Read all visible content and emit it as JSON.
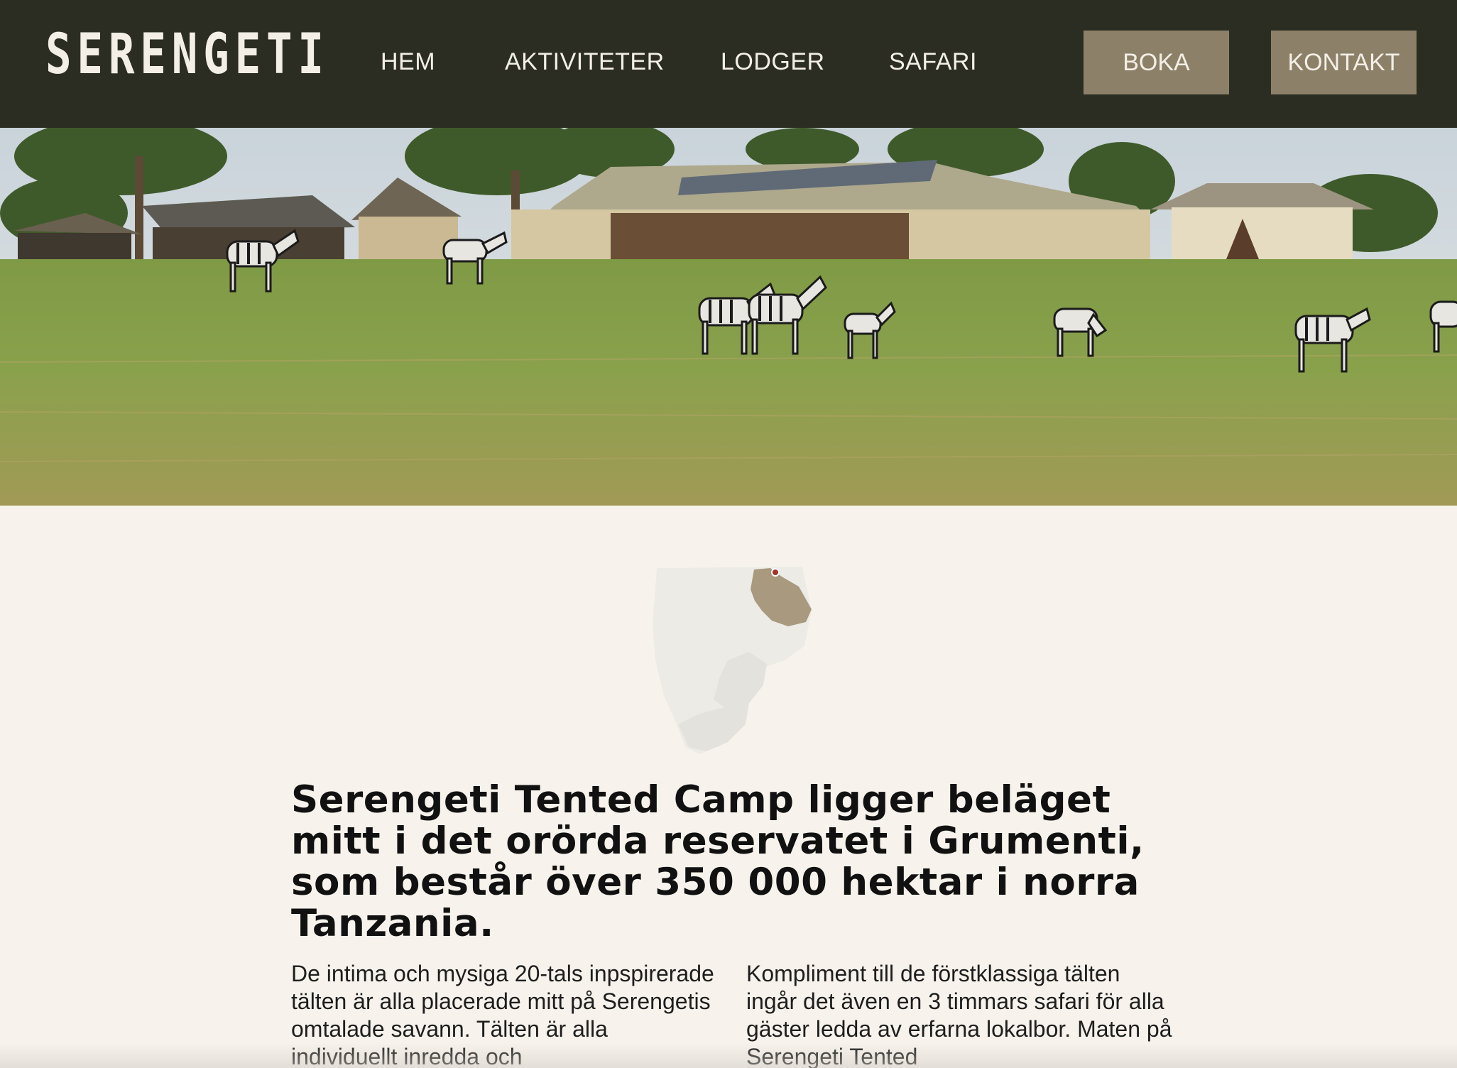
{
  "header": {
    "logo": "SERENGETI",
    "nav": [
      {
        "label": "HEM"
      },
      {
        "label": "AKTIVITETER"
      },
      {
        "label": "LODGER"
      },
      {
        "label": "SAFARI"
      }
    ],
    "boka_label": "BOKA",
    "kontakt_label": "KONTAKT"
  },
  "colors": {
    "nav_bg": "#2b2d23",
    "button_bg": "#8d8068",
    "page_bg": "#f7f3ec",
    "map_highlight": "#a8997f",
    "map_marker": "#a0352a"
  },
  "hero": {
    "image": "photo of safari tent camp with zebras grazing on savanna"
  },
  "intro": {
    "headline": "Serengeti Tented Camp ligger beläget mitt i det orörda reservatet i Grumenti, som består över 350 000 hektar i norra Tanzania.",
    "left_text": "De intima och mysiga 20-tals inpspirerade tälten är alla placerade mitt på Serengetis omtalade savann. Tälten är alla individuellt inredda och",
    "right_text": "Kompliment till de förstklassiga tälten ingår det även en 3 timmars safari för alla gäster ledda av erfarna lokalbor. Maten på Serengeti Tented"
  }
}
